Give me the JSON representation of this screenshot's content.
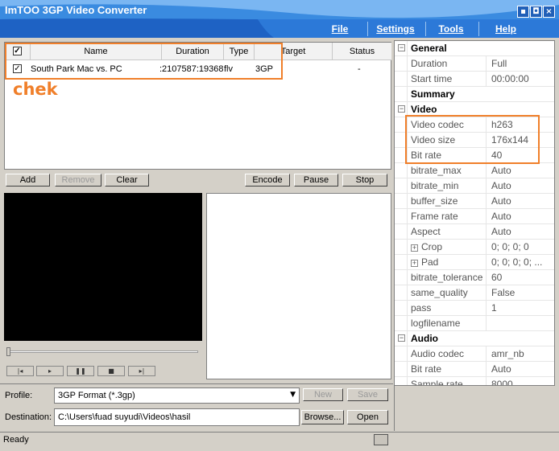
{
  "app": {
    "title": "ImTOO 3GP Video Converter"
  },
  "window_buttons": {
    "minimize": "▪",
    "restore": "◘",
    "close": "×"
  },
  "menu": [
    "File",
    "Settings",
    "Tools",
    "Help"
  ],
  "file_list": {
    "columns": [
      "Name",
      "Duration",
      "Type",
      "Target",
      "Status"
    ],
    "rows": [
      {
        "checked": true,
        "name": "South Park Mac vs. PC",
        "duration": ":2107587:19368",
        "type": "flv",
        "target": "3GP",
        "status": "-"
      }
    ]
  },
  "annotation": "chek",
  "list_buttons": {
    "add": "Add",
    "remove": "Remove",
    "clear": "Clear",
    "encode": "Encode",
    "pause": "Pause",
    "stop": "Stop"
  },
  "player_controls": [
    "|◂",
    "▸",
    "❚❚",
    "■",
    "▸|"
  ],
  "properties": [
    {
      "kind": "group",
      "label": "General",
      "toggle": "−"
    },
    {
      "kind": "row",
      "name": "Duration",
      "value": "Full"
    },
    {
      "kind": "row",
      "name": "Start time",
      "value": "00:00:00"
    },
    {
      "kind": "sub",
      "label": "Summary"
    },
    {
      "kind": "group",
      "label": "Video",
      "toggle": "−"
    },
    {
      "kind": "row",
      "name": "Video codec",
      "value": "h263"
    },
    {
      "kind": "row",
      "name": "Video size",
      "value": "176x144"
    },
    {
      "kind": "row",
      "name": "Bit rate",
      "value": "40"
    },
    {
      "kind": "row",
      "name": "bitrate_max",
      "value": "Auto"
    },
    {
      "kind": "row",
      "name": "bitrate_min",
      "value": "Auto"
    },
    {
      "kind": "row",
      "name": "buffer_size",
      "value": "Auto"
    },
    {
      "kind": "row",
      "name": "Frame rate",
      "value": "Auto"
    },
    {
      "kind": "row",
      "name": "Aspect",
      "value": "Auto"
    },
    {
      "kind": "row",
      "name": "Crop",
      "value": "0; 0; 0; 0",
      "expand": "+"
    },
    {
      "kind": "row",
      "name": "Pad",
      "value": "0; 0; 0; 0; ...",
      "expand": "+"
    },
    {
      "kind": "row",
      "name": "bitrate_tolerance",
      "value": "60"
    },
    {
      "kind": "row",
      "name": "same_quality",
      "value": "False"
    },
    {
      "kind": "row",
      "name": "pass",
      "value": "1"
    },
    {
      "kind": "row",
      "name": "logfilename",
      "value": ""
    },
    {
      "kind": "group",
      "label": "Audio",
      "toggle": "−"
    },
    {
      "kind": "row",
      "name": "Audio codec",
      "value": "amr_nb"
    },
    {
      "kind": "row",
      "name": "Bit rate",
      "value": "Auto"
    },
    {
      "kind": "row",
      "name": "Sample rate",
      "value": "8000"
    }
  ],
  "profile": {
    "label": "Profile:",
    "value": "3GP Format  (*.3gp)",
    "new": "New",
    "save": "Save"
  },
  "destination": {
    "label": "Destination:",
    "value": "C:\\Users\\fuad suyudi\\Videos\\hasil",
    "browse": "Browse...",
    "open": "Open"
  },
  "status": {
    "text": "Ready"
  },
  "colors": {
    "title_blue": "#3a8be0",
    "highlight_orange": "#f07f2a"
  }
}
